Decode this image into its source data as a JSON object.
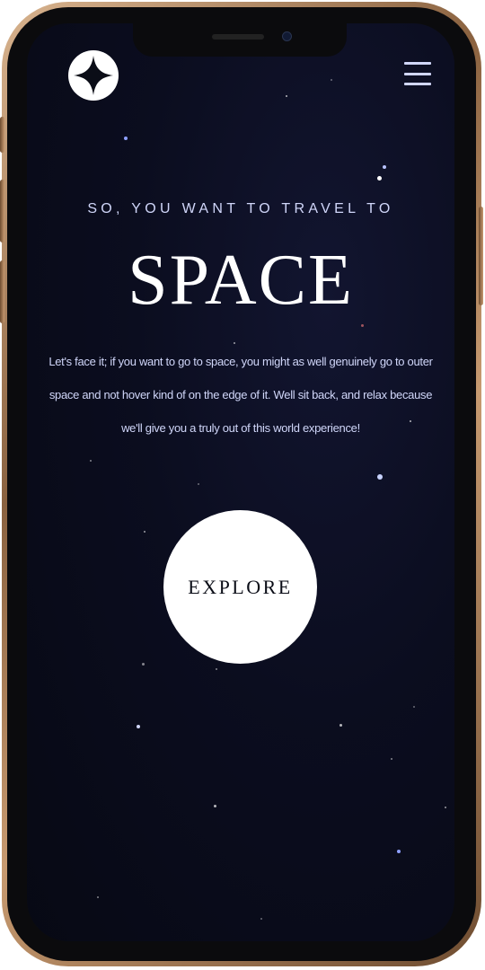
{
  "header": {
    "logo_icon": "four-point-star-icon",
    "menu_icon": "hamburger-menu-icon"
  },
  "hero": {
    "eyebrow": "SO, YOU WANT TO TRAVEL TO",
    "title": "SPACE",
    "description": "Let's face it; if you want to go to space, you might as well genuinely go to outer space and not hover kind of on the edge of it. Well sit back, and relax because we'll give you a truly out of this world experience!",
    "explore_label": "EXPLORE"
  },
  "colors": {
    "background": "#0b0d17",
    "text_light": "#d0d6f9",
    "white": "#ffffff",
    "frame": "#c79a70"
  }
}
